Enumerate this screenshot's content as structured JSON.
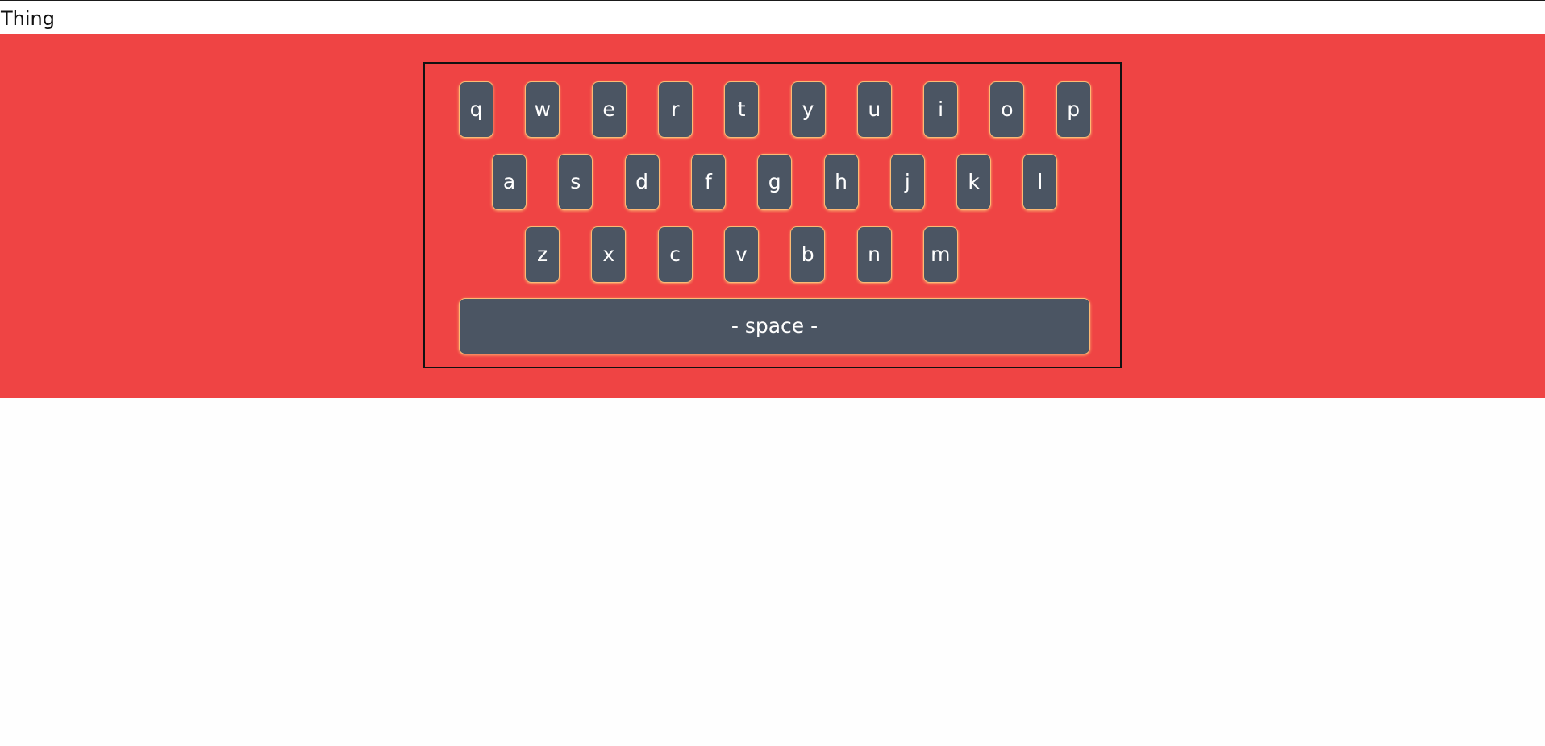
{
  "header": {
    "title": "Thing"
  },
  "colors": {
    "band": "#ef4444",
    "key": "#4b5563",
    "key_border": "#fdba74",
    "keyboard_border": "#111111"
  },
  "keyboard": {
    "rows": [
      [
        "q",
        "w",
        "e",
        "r",
        "t",
        "y",
        "u",
        "i",
        "o",
        "p"
      ],
      [
        "a",
        "s",
        "d",
        "f",
        "g",
        "h",
        "j",
        "k",
        "l"
      ],
      [
        "z",
        "x",
        "c",
        "v",
        "b",
        "n",
        "m"
      ]
    ],
    "space_label": "- space -"
  }
}
